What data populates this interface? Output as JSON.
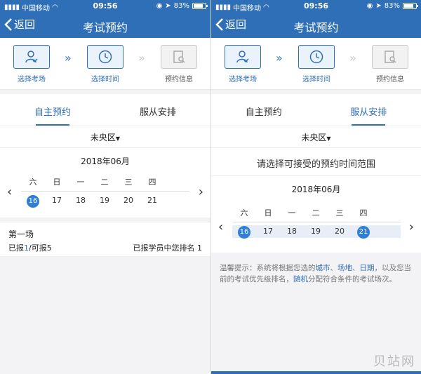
{
  "status": {
    "carrier": "中国移动",
    "time": "09:56",
    "battery": "83%",
    "battery_level": 0.83
  },
  "nav": {
    "back_label": "返回",
    "title": "考试预约"
  },
  "steps": [
    {
      "label": "选择考场",
      "state": "done"
    },
    {
      "label": "选择时间",
      "state": "active"
    },
    {
      "label": "预约信息",
      "state": "disabled"
    }
  ],
  "tabs": [
    "自主预约",
    "服从安排"
  ],
  "district": "未央区",
  "calendar": {
    "month": "2018年06月",
    "weekdays": [
      "六",
      "日",
      "一",
      "二",
      "三",
      "四"
    ],
    "dates": [
      "16",
      "17",
      "18",
      "19",
      "20",
      "21"
    ]
  },
  "session": {
    "name": "第一场",
    "quota_prefix": "已报",
    "quota_num": "1",
    "quota_suffix": "/可报5",
    "rank_label": "已报学员中您排名",
    "rank_value": "1"
  },
  "right": {
    "range_hint": "请选择可接受的预约时间范围",
    "tips": {
      "prefix": "温馨提示：系统将根据您选的",
      "city": "城市",
      "sep1": "、",
      "venue": "场地",
      "sep2": "、",
      "date": "日期",
      "mid": "，以及您当前的考试优先级排名，",
      "random": "随机",
      "suffix": "分配符合条件的考试场次。"
    }
  },
  "watermark": "贝站网",
  "colors": {
    "primary": "#2f6fb7",
    "selected_date": "#2f7fd8"
  }
}
